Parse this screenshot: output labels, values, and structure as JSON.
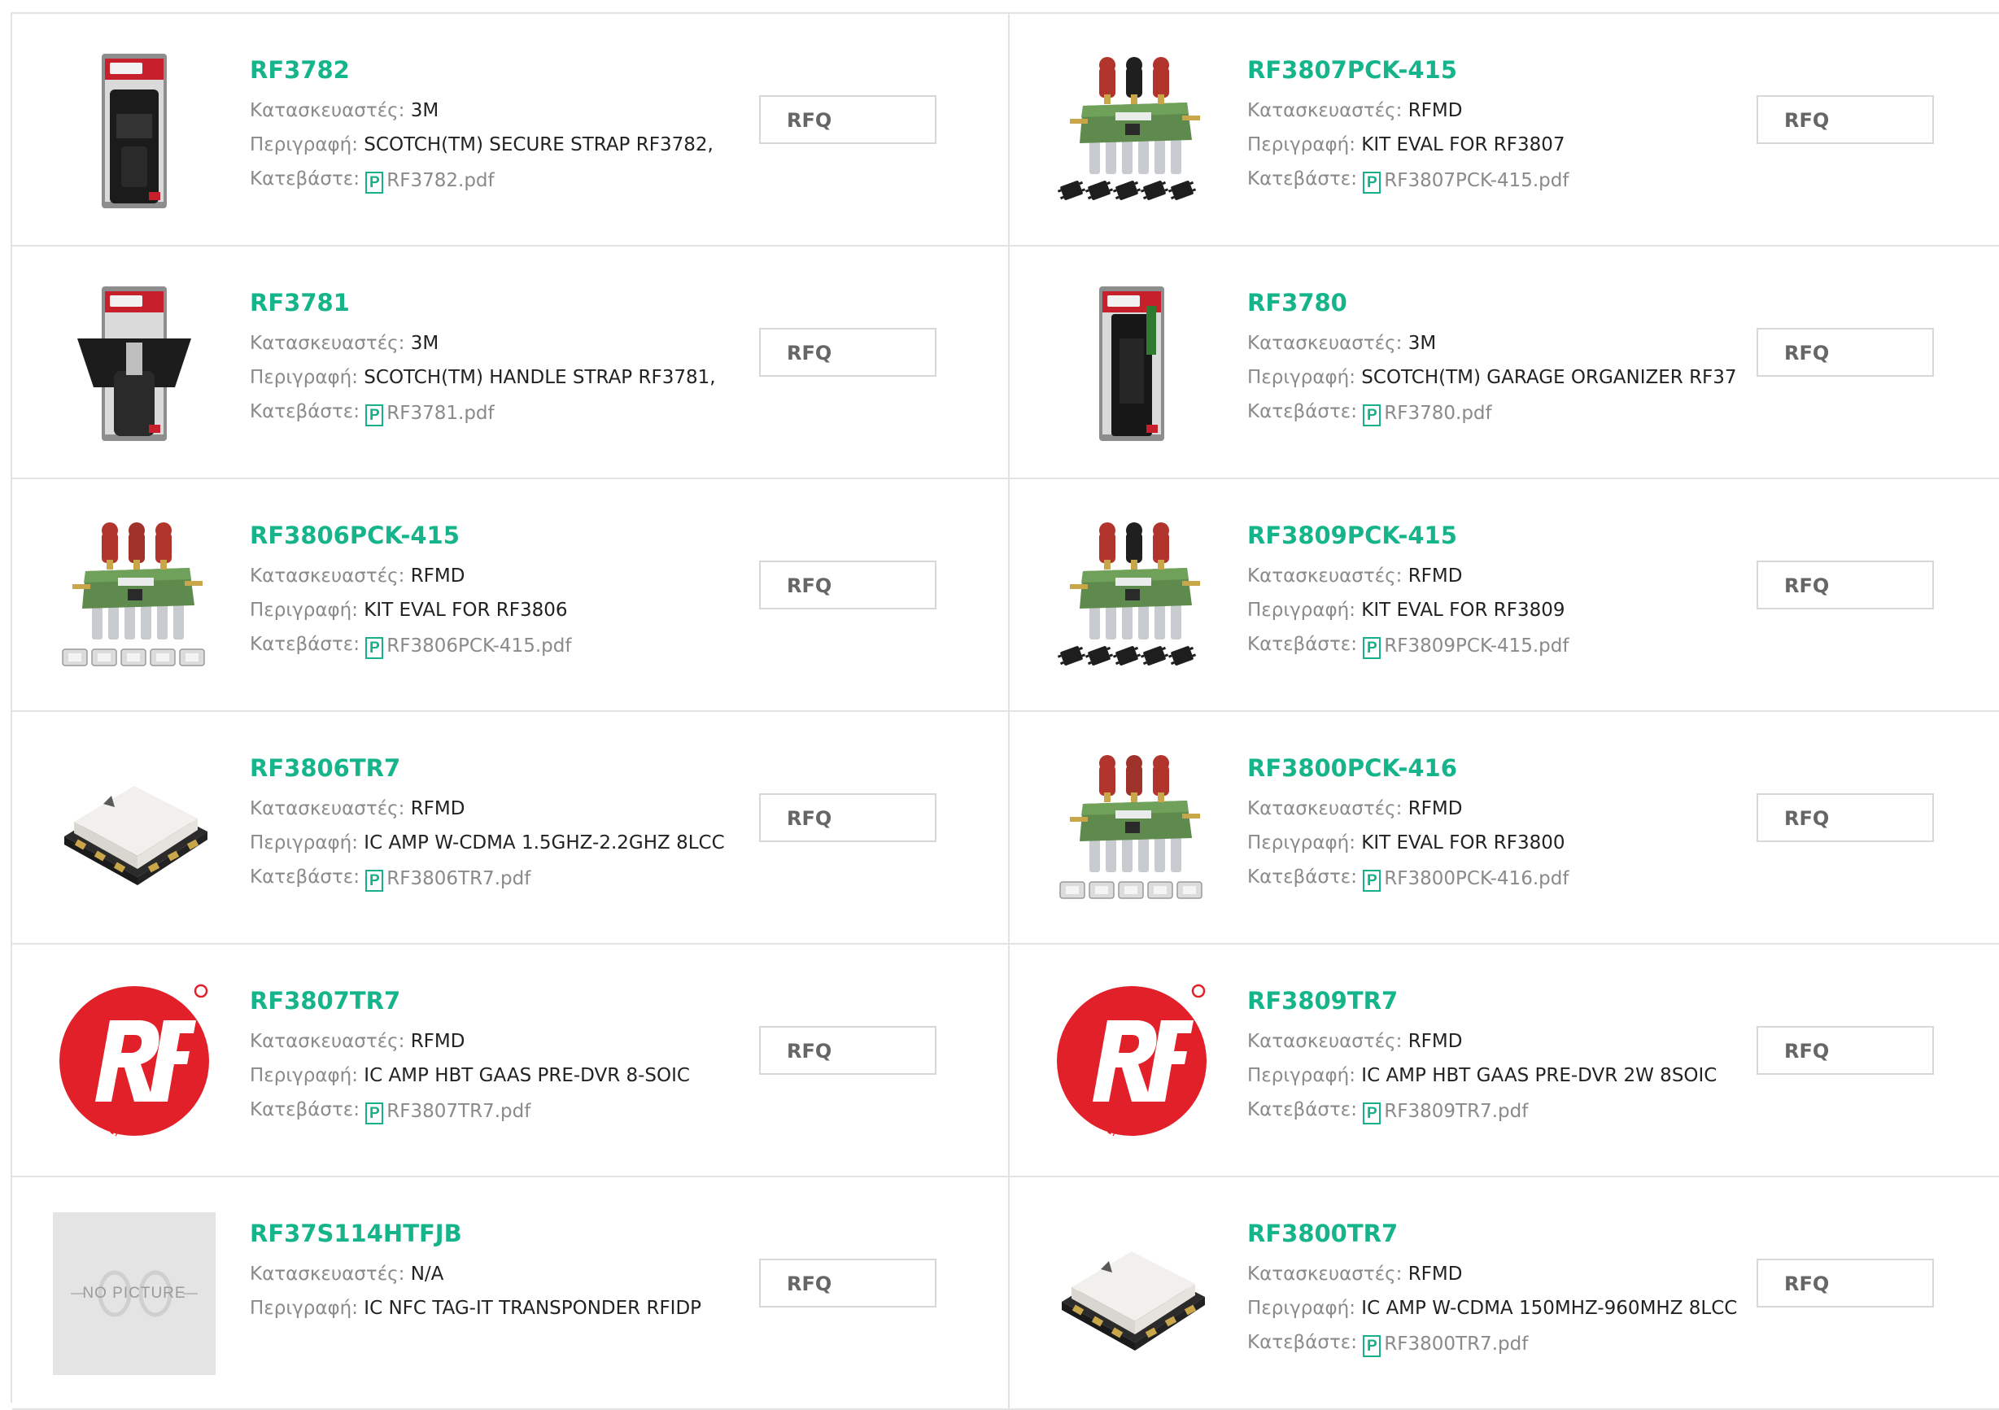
{
  "labels": {
    "manufacturer": "Κατασκευαστές:",
    "description": "Περιγραφή:",
    "download": "Κατεβάστε:",
    "rfq": "RFQ",
    "pdf_icon": "P"
  },
  "products": [
    {
      "name": "RF3782",
      "manufacturer": "3M",
      "description": "SCOTCH(TM) SECURE STRAP RF3782,",
      "pdf": "RF3782.pdf",
      "image": "scotch-strap-black"
    },
    {
      "name": "RF3807PCK-415",
      "manufacturer": "RFMD",
      "description": "KIT EVAL FOR RF3807",
      "pdf": "RF3807PCK-415.pdf",
      "image": "eval-board-dark-chips"
    },
    {
      "name": "RF3781",
      "manufacturer": "3M",
      "description": "SCOTCH(TM) HANDLE STRAP RF3781,",
      "pdf": "RF3781.pdf",
      "image": "scotch-handle-strap"
    },
    {
      "name": "RF3780",
      "manufacturer": "3M",
      "description": "SCOTCH(TM) GARAGE ORGANIZER RF37",
      "pdf": "RF3780.pdf",
      "image": "scotch-garage-organizer"
    },
    {
      "name": "RF3806PCK-415",
      "manufacturer": "RFMD",
      "description": "KIT EVAL FOR RF3806",
      "pdf": "RF3806PCK-415.pdf",
      "image": "eval-board-light-chips"
    },
    {
      "name": "RF3809PCK-415",
      "manufacturer": "RFMD",
      "description": "KIT EVAL FOR RF3809",
      "pdf": "RF3809PCK-415.pdf",
      "image": "eval-board-dark-chips"
    },
    {
      "name": "RF3806TR7",
      "manufacturer": "RFMD",
      "description": "IC AMP W-CDMA 1.5GHZ-2.2GHZ 8LCC",
      "pdf": "RF3806TR7.pdf",
      "image": "lcc-chip"
    },
    {
      "name": "RF3800PCK-416",
      "manufacturer": "RFMD",
      "description": "KIT EVAL FOR RF3800",
      "pdf": "RF3800PCK-416.pdf",
      "image": "eval-board-light-chips"
    },
    {
      "name": "RF3807TR7",
      "manufacturer": "RFMD",
      "description": "IC AMP HBT GAAS PRE-DVR 8-SOIC",
      "pdf": "RF3807TR7.pdf",
      "image": "rf-solutions-logo"
    },
    {
      "name": "RF3809TR7",
      "manufacturer": "RFMD",
      "description": "IC AMP HBT GAAS PRE-DVR 2W 8SOIC",
      "pdf": "RF3809TR7.pdf",
      "image": "rf-solutions-logo"
    },
    {
      "name": "RF37S114HTFJB",
      "manufacturer": "N/A",
      "description": "IC NFC TAG-IT TRANSPONDER RFIDP",
      "pdf": "",
      "image": "no-picture",
      "no_picture_text": "NO PICTURE"
    },
    {
      "name": "RF3800TR7",
      "manufacturer": "RFMD",
      "description": "IC AMP W-CDMA 150MHZ-960MHZ 8LCC",
      "pdf": "RF3800TR7.pdf",
      "image": "lcc-chip"
    }
  ],
  "colors": {
    "accent_green": "#16b48a",
    "label_gray": "#8a8a8a",
    "border_gray": "#e3e3e3",
    "rf_logo_red": "#e2202a"
  }
}
